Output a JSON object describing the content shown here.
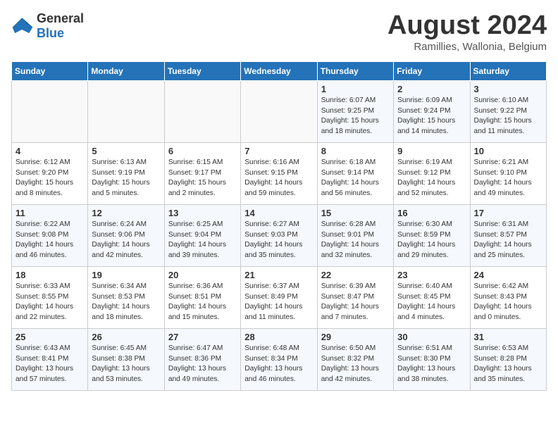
{
  "logo": {
    "general": "General",
    "blue": "Blue"
  },
  "title": {
    "month_year": "August 2024",
    "location": "Ramillies, Wallonia, Belgium"
  },
  "days_of_week": [
    "Sunday",
    "Monday",
    "Tuesday",
    "Wednesday",
    "Thursday",
    "Friday",
    "Saturday"
  ],
  "weeks": [
    [
      {
        "day": "",
        "info": ""
      },
      {
        "day": "",
        "info": ""
      },
      {
        "day": "",
        "info": ""
      },
      {
        "day": "",
        "info": ""
      },
      {
        "day": "1",
        "info": "Sunrise: 6:07 AM\nSunset: 9:25 PM\nDaylight: 15 hours\nand 18 minutes."
      },
      {
        "day": "2",
        "info": "Sunrise: 6:09 AM\nSunset: 9:24 PM\nDaylight: 15 hours\nand 14 minutes."
      },
      {
        "day": "3",
        "info": "Sunrise: 6:10 AM\nSunset: 9:22 PM\nDaylight: 15 hours\nand 11 minutes."
      }
    ],
    [
      {
        "day": "4",
        "info": "Sunrise: 6:12 AM\nSunset: 9:20 PM\nDaylight: 15 hours\nand 8 minutes."
      },
      {
        "day": "5",
        "info": "Sunrise: 6:13 AM\nSunset: 9:19 PM\nDaylight: 15 hours\nand 5 minutes."
      },
      {
        "day": "6",
        "info": "Sunrise: 6:15 AM\nSunset: 9:17 PM\nDaylight: 15 hours\nand 2 minutes."
      },
      {
        "day": "7",
        "info": "Sunrise: 6:16 AM\nSunset: 9:15 PM\nDaylight: 14 hours\nand 59 minutes."
      },
      {
        "day": "8",
        "info": "Sunrise: 6:18 AM\nSunset: 9:14 PM\nDaylight: 14 hours\nand 56 minutes."
      },
      {
        "day": "9",
        "info": "Sunrise: 6:19 AM\nSunset: 9:12 PM\nDaylight: 14 hours\nand 52 minutes."
      },
      {
        "day": "10",
        "info": "Sunrise: 6:21 AM\nSunset: 9:10 PM\nDaylight: 14 hours\nand 49 minutes."
      }
    ],
    [
      {
        "day": "11",
        "info": "Sunrise: 6:22 AM\nSunset: 9:08 PM\nDaylight: 14 hours\nand 46 minutes."
      },
      {
        "day": "12",
        "info": "Sunrise: 6:24 AM\nSunset: 9:06 PM\nDaylight: 14 hours\nand 42 minutes."
      },
      {
        "day": "13",
        "info": "Sunrise: 6:25 AM\nSunset: 9:04 PM\nDaylight: 14 hours\nand 39 minutes."
      },
      {
        "day": "14",
        "info": "Sunrise: 6:27 AM\nSunset: 9:03 PM\nDaylight: 14 hours\nand 35 minutes."
      },
      {
        "day": "15",
        "info": "Sunrise: 6:28 AM\nSunset: 9:01 PM\nDaylight: 14 hours\nand 32 minutes."
      },
      {
        "day": "16",
        "info": "Sunrise: 6:30 AM\nSunset: 8:59 PM\nDaylight: 14 hours\nand 29 minutes."
      },
      {
        "day": "17",
        "info": "Sunrise: 6:31 AM\nSunset: 8:57 PM\nDaylight: 14 hours\nand 25 minutes."
      }
    ],
    [
      {
        "day": "18",
        "info": "Sunrise: 6:33 AM\nSunset: 8:55 PM\nDaylight: 14 hours\nand 22 minutes."
      },
      {
        "day": "19",
        "info": "Sunrise: 6:34 AM\nSunset: 8:53 PM\nDaylight: 14 hours\nand 18 minutes."
      },
      {
        "day": "20",
        "info": "Sunrise: 6:36 AM\nSunset: 8:51 PM\nDaylight: 14 hours\nand 15 minutes."
      },
      {
        "day": "21",
        "info": "Sunrise: 6:37 AM\nSunset: 8:49 PM\nDaylight: 14 hours\nand 11 minutes."
      },
      {
        "day": "22",
        "info": "Sunrise: 6:39 AM\nSunset: 8:47 PM\nDaylight: 14 hours\nand 7 minutes."
      },
      {
        "day": "23",
        "info": "Sunrise: 6:40 AM\nSunset: 8:45 PM\nDaylight: 14 hours\nand 4 minutes."
      },
      {
        "day": "24",
        "info": "Sunrise: 6:42 AM\nSunset: 8:43 PM\nDaylight: 14 hours\nand 0 minutes."
      }
    ],
    [
      {
        "day": "25",
        "info": "Sunrise: 6:43 AM\nSunset: 8:41 PM\nDaylight: 13 hours\nand 57 minutes."
      },
      {
        "day": "26",
        "info": "Sunrise: 6:45 AM\nSunset: 8:38 PM\nDaylight: 13 hours\nand 53 minutes."
      },
      {
        "day": "27",
        "info": "Sunrise: 6:47 AM\nSunset: 8:36 PM\nDaylight: 13 hours\nand 49 minutes."
      },
      {
        "day": "28",
        "info": "Sunrise: 6:48 AM\nSunset: 8:34 PM\nDaylight: 13 hours\nand 46 minutes."
      },
      {
        "day": "29",
        "info": "Sunrise: 6:50 AM\nSunset: 8:32 PM\nDaylight: 13 hours\nand 42 minutes."
      },
      {
        "day": "30",
        "info": "Sunrise: 6:51 AM\nSunset: 8:30 PM\nDaylight: 13 hours\nand 38 minutes."
      },
      {
        "day": "31",
        "info": "Sunrise: 6:53 AM\nSunset: 8:28 PM\nDaylight: 13 hours\nand 35 minutes."
      }
    ]
  ]
}
